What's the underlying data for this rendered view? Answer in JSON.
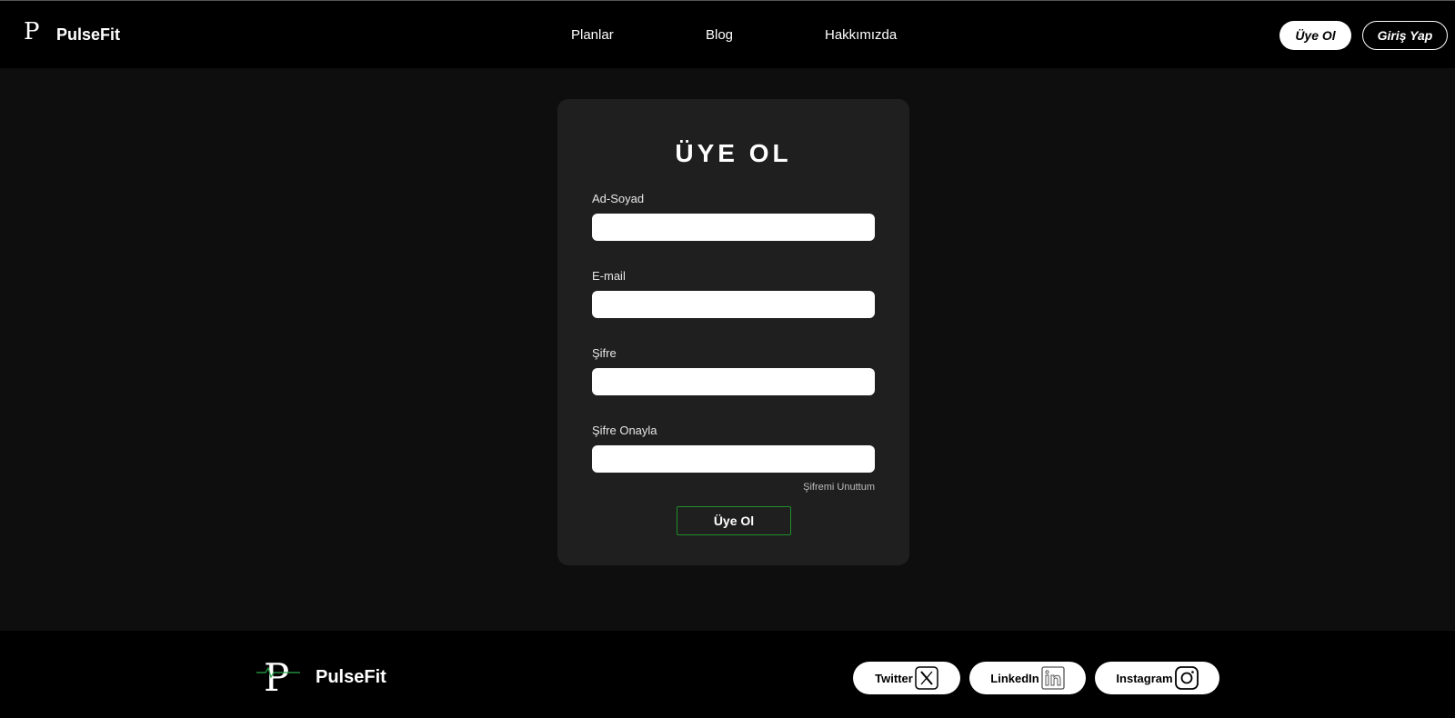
{
  "header": {
    "brand": "PulseFit",
    "logo_letter": "P",
    "nav": [
      "Planlar",
      "Blog",
      "Hakkımızda"
    ],
    "signup_label": "Üye Ol",
    "login_label": "Giriş Yap"
  },
  "form": {
    "title": "ÜYE OL",
    "fields": [
      {
        "label": "Ad-Soyad",
        "value": ""
      },
      {
        "label": "E-mail",
        "value": ""
      },
      {
        "label": "Şifre",
        "value": ""
      },
      {
        "label": "Şifre Onayla",
        "value": ""
      }
    ],
    "forgot_label": "Şifremi Unuttum",
    "submit_label": "Üye Ol"
  },
  "footer": {
    "brand": "PulseFit",
    "logo_letter": "P",
    "socials": [
      {
        "label": "Twitter",
        "icon": "x-icon"
      },
      {
        "label": "LinkedIn",
        "icon": "linkedin-icon"
      },
      {
        "label": "Instagram",
        "icon": "instagram-icon"
      }
    ]
  },
  "colors": {
    "background": "#0e0e0e",
    "header": "#000000",
    "card": "#1f1f1f",
    "accent_border": "#1f8f2a"
  }
}
